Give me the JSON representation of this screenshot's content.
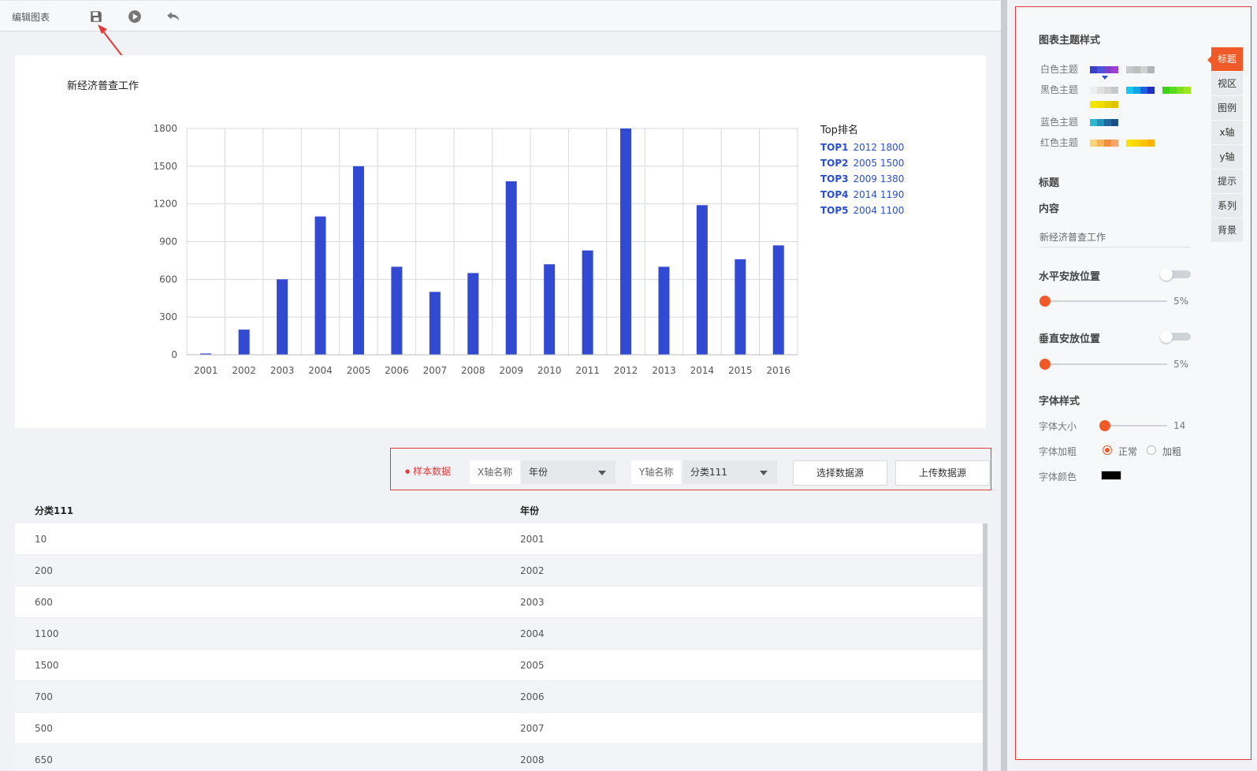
{
  "toolbar": {
    "title": "编辑图表"
  },
  "chart": {
    "title": "新经济普查工作"
  },
  "chart_data": {
    "type": "bar",
    "categories": [
      "2001",
      "2002",
      "2003",
      "2004",
      "2005",
      "2006",
      "2007",
      "2008",
      "2009",
      "2010",
      "2011",
      "2012",
      "2013",
      "2014",
      "2015",
      "2016"
    ],
    "values": [
      10,
      200,
      600,
      1100,
      1500,
      700,
      500,
      650,
      1380,
      720,
      830,
      1800,
      700,
      1190,
      760,
      870
    ],
    "yticks": [
      0,
      300,
      600,
      900,
      1200,
      1500,
      1800
    ],
    "ylim": [
      0,
      1800
    ],
    "grid": true,
    "color": "#3249d1",
    "legend": {
      "title": "Top排名",
      "placement": "right",
      "items": [
        {
          "rank": "TOP1",
          "year": "2012",
          "value": "1800"
        },
        {
          "rank": "TOP2",
          "year": "2005",
          "value": "1500"
        },
        {
          "rank": "TOP3",
          "year": "2009",
          "value": "1380"
        },
        {
          "rank": "TOP4",
          "year": "2014",
          "value": "1190"
        },
        {
          "rank": "TOP5",
          "year": "2004",
          "value": "1100"
        }
      ]
    }
  },
  "source": {
    "sample_label": "样本数据",
    "x_label": "X轴名称",
    "x_value": "年份",
    "y_label": "Y轴名称",
    "y_value": "分类111",
    "select_btn": "选择数据源",
    "upload_btn": "上传数据源"
  },
  "table": {
    "headers": [
      "分类111",
      "年份"
    ],
    "rows": [
      [
        "10",
        "2001"
      ],
      [
        "200",
        "2002"
      ],
      [
        "600",
        "2003"
      ],
      [
        "1100",
        "2004"
      ],
      [
        "1500",
        "2005"
      ],
      [
        "700",
        "2006"
      ],
      [
        "500",
        "2007"
      ],
      [
        "650",
        "2008"
      ]
    ]
  },
  "panel": {
    "theme_header": "图表主题样式",
    "themes": {
      "white": "白色主题",
      "black": "黑色主题",
      "blue": "蓝色主题",
      "red": "红色主题"
    },
    "title_header": "标题",
    "content_header": "内容",
    "content_value": "新经济普查工作",
    "hpos_header": "水平安放位置",
    "hpos_value": "5%",
    "vpos_header": "垂直安放位置",
    "vpos_value": "5%",
    "font_header": "字体样式",
    "font_size_label": "字体大小",
    "font_size_value": "14",
    "font_weight_label": "字体加粗",
    "weight_normal": "正常",
    "weight_bold": "加粗",
    "font_color_label": "字体颜色",
    "font_color": "#000000"
  },
  "tabs": [
    "标题",
    "视区",
    "图例",
    "x轴",
    "y轴",
    "提示",
    "系列",
    "背景"
  ]
}
